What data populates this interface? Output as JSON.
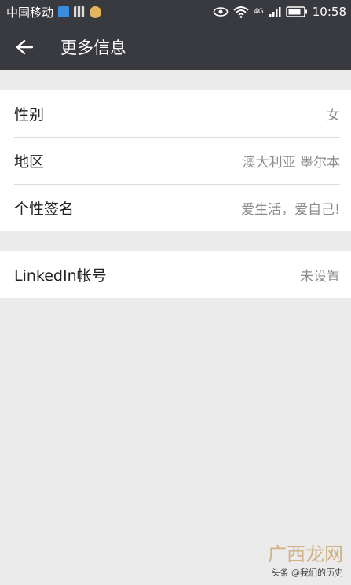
{
  "status_bar": {
    "carrier": "中国移动",
    "network": "4G",
    "time": "10:58"
  },
  "header": {
    "title": "更多信息"
  },
  "sections": [
    {
      "rows": [
        {
          "label": "性别",
          "value": "女"
        },
        {
          "label": "地区",
          "value": "澳大利亚 墨尔本"
        },
        {
          "label": "个性签名",
          "value": "爱生活，爱自己!"
        }
      ]
    },
    {
      "rows": [
        {
          "label": "LinkedIn帐号",
          "value": "未设置"
        }
      ]
    }
  ],
  "watermark": {
    "logo": "广西龙网",
    "credit": "头条 @我们的历史"
  },
  "colors": {
    "bar": "#393a3f",
    "background": "#ebebeb",
    "secondary_text": "#8c8c8c"
  }
}
